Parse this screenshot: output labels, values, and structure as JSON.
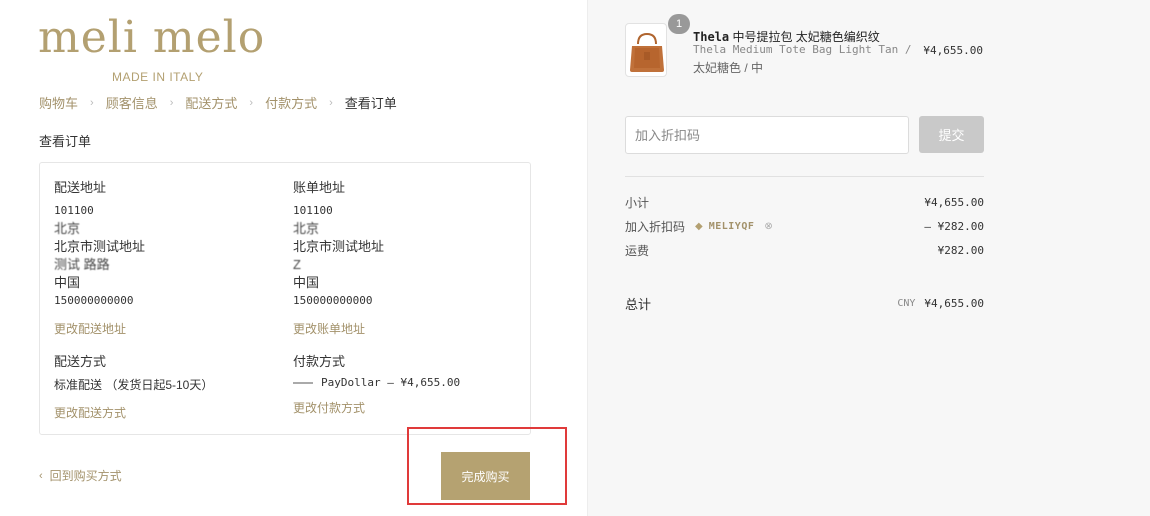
{
  "brand": {
    "logo_text": "meli melo",
    "tagline": "MADE IN ITALY"
  },
  "breadcrumb": [
    {
      "label": "购物车"
    },
    {
      "label": "顾客信息"
    },
    {
      "label": "配送方式"
    },
    {
      "label": "付款方式"
    },
    {
      "label": "查看订单"
    }
  ],
  "review": {
    "title": "查看订单",
    "shipping_address": {
      "heading": "配送地址",
      "lines": [
        "101100",
        "北京",
        "北京市测试地址",
        "测试 路路",
        "中国",
        "150000000000"
      ],
      "change_link": "更改配送地址"
    },
    "billing_address": {
      "heading": "账单地址",
      "lines": [
        "101100",
        "北京",
        "北京市测试地址",
        "Z",
        "中国",
        "150000000000"
      ],
      "change_link": "更改账单地址"
    },
    "shipping_method": {
      "heading": "配送方式",
      "value": "标准配送 （发货日起5-10天）",
      "change_link": "更改配送方式"
    },
    "payment_method": {
      "heading": "付款方式",
      "value": "PayDollar — ¥4,655.00",
      "change_link": "更改付款方式"
    }
  },
  "actions": {
    "back_label": "回到购买方式",
    "back_icon": "chevron-left-icon",
    "complete_label": "完成购买"
  },
  "order_summary": {
    "item": {
      "quantity": "1",
      "name_en": "Thela",
      "name_cn": " 中号提拉包 太妃糖色编织纹",
      "variant_en": "Thela Medium Tote Bag Light Tan /",
      "variant_cn": "太妃糖色 / 中",
      "price": "¥4,655.00"
    },
    "discount": {
      "placeholder": "加入折扣码",
      "submit_label": "提交"
    },
    "subtotal": {
      "label": "小计",
      "value": "¥4,655.00"
    },
    "discount_applied": {
      "label": "加入折扣码",
      "code": "MELIYQF",
      "value": "– ¥282.00"
    },
    "shipping": {
      "label": "运费",
      "value": "¥282.00"
    },
    "total": {
      "label": "总计",
      "currency": "CNY",
      "value": "¥4,655.00"
    }
  },
  "colors": {
    "accent": "#a3926b",
    "button": "#b5a271",
    "highlight": "#e03a3a",
    "sidebar_bg": "#f7f7f7"
  }
}
